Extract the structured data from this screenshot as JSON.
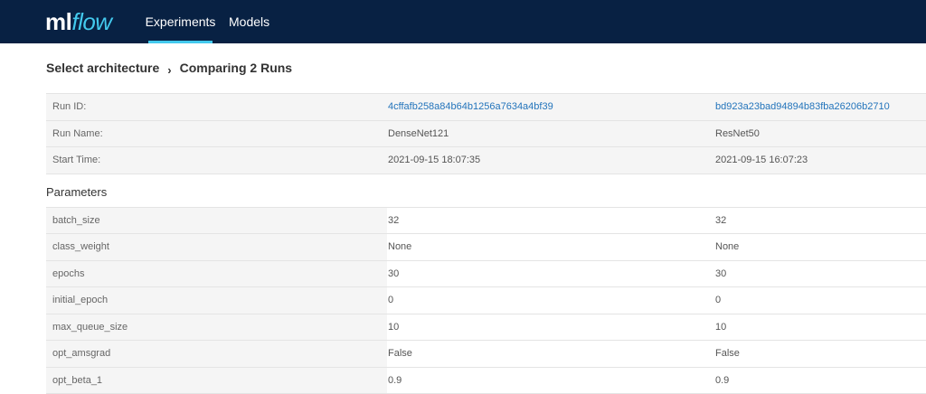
{
  "brand": {
    "ml": "ml",
    "flow": "flow",
    "accent": "#43C9ED",
    "header_bg": "#082143"
  },
  "nav": {
    "experiments": "Experiments",
    "models": "Models"
  },
  "breadcrumb": {
    "parent": "Select architecture",
    "current": "Comparing 2 Runs"
  },
  "run_info": {
    "run_id_label": "Run ID:",
    "run_ids": [
      "4cffafb258a84b64b1256a7634a4bf39",
      "bd923a23bad94894b83fba26206b2710"
    ],
    "run_name_label": "Run Name:",
    "run_names": [
      "DenseNet121",
      "ResNet50"
    ],
    "start_time_label": "Start Time:",
    "start_times": [
      "2021-09-15 18:07:35",
      "2021-09-15 16:07:23"
    ]
  },
  "parameters": {
    "title": "Parameters",
    "rows": [
      {
        "key": "batch_size",
        "values": [
          "32",
          "32"
        ]
      },
      {
        "key": "class_weight",
        "values": [
          "None",
          "None"
        ]
      },
      {
        "key": "epochs",
        "values": [
          "30",
          "30"
        ]
      },
      {
        "key": "initial_epoch",
        "values": [
          "0",
          "0"
        ]
      },
      {
        "key": "max_queue_size",
        "values": [
          "10",
          "10"
        ]
      },
      {
        "key": "opt_amsgrad",
        "values": [
          "False",
          "False"
        ]
      },
      {
        "key": "opt_beta_1",
        "values": [
          "0.9",
          "0.9"
        ]
      }
    ]
  }
}
